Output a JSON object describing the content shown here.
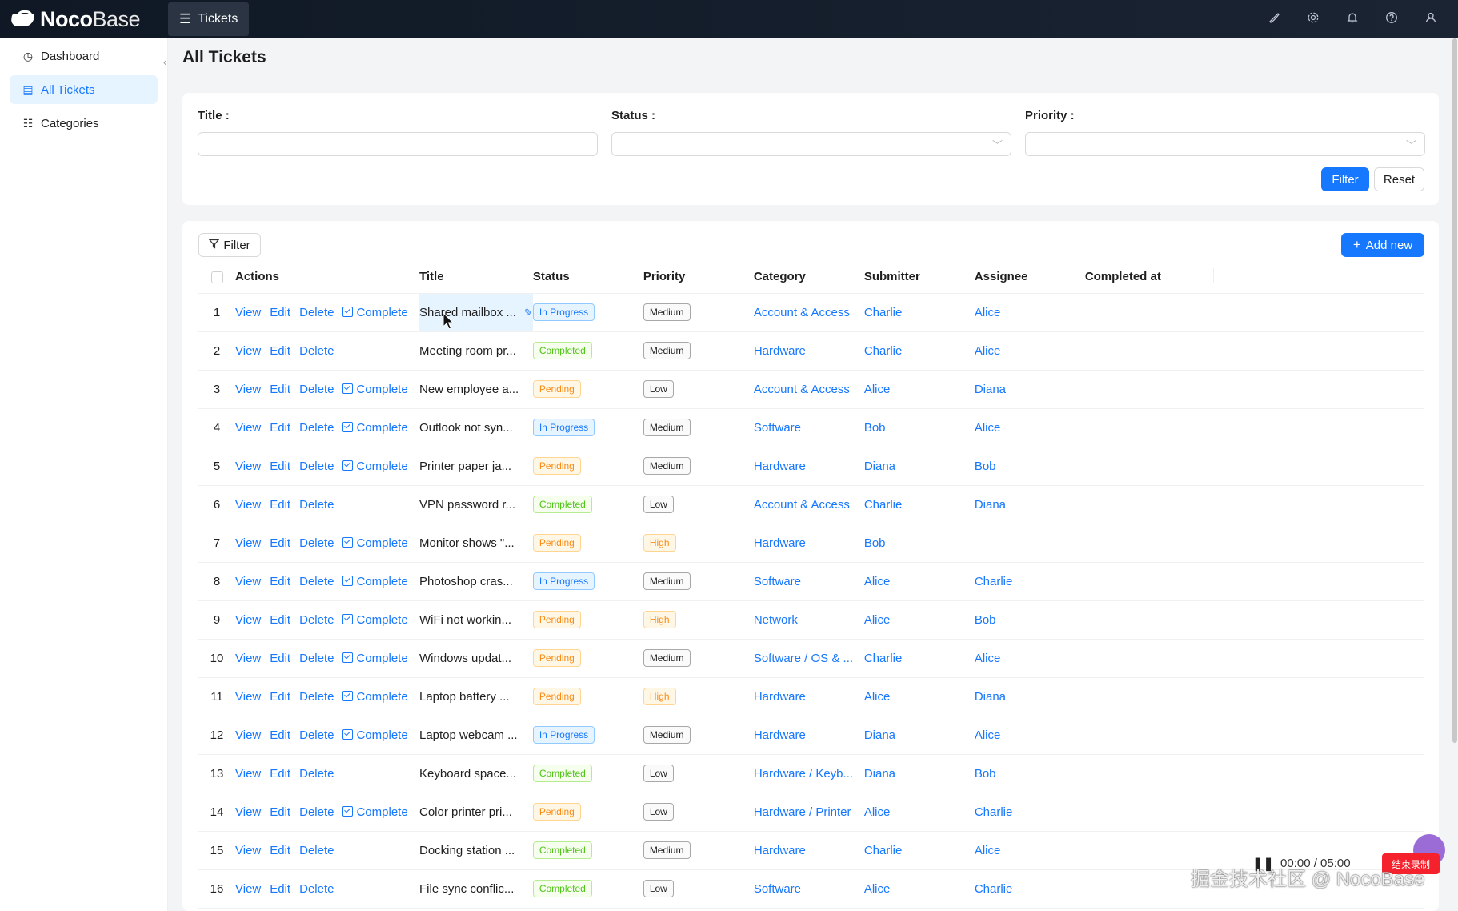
{
  "app": {
    "logo_bold": "Noco",
    "logo_light": "Base",
    "menu_tab": "Tickets"
  },
  "sidebar": {
    "items": [
      {
        "label": "Dashboard",
        "icon": "dashboard-icon",
        "active": false
      },
      {
        "label": "All Tickets",
        "icon": "file-icon",
        "active": true
      },
      {
        "label": "Categories",
        "icon": "list-icon",
        "active": false
      }
    ]
  },
  "page": {
    "title": "All Tickets"
  },
  "filter_form": {
    "title_label": "Title :",
    "status_label": "Status :",
    "priority_label": "Priority :",
    "filter_button": "Filter",
    "reset_button": "Reset"
  },
  "table_toolbar": {
    "filter_button": "Filter",
    "add_new_button": "Add new"
  },
  "table": {
    "columns": [
      "Actions",
      "Title",
      "Status",
      "Priority",
      "Category",
      "Submitter",
      "Assignee",
      "Completed at"
    ],
    "action_labels": {
      "view": "View",
      "edit": "Edit",
      "delete": "Delete",
      "complete": "Complete"
    },
    "rows": [
      {
        "n": "1",
        "complete": true,
        "title": "Shared mailbox ...",
        "status": "In Progress",
        "priority": "Medium",
        "category": "Account & Access",
        "submitter": "Charlie",
        "assignee": "Alice"
      },
      {
        "n": "2",
        "complete": false,
        "title": "Meeting room pr...",
        "status": "Completed",
        "priority": "Medium",
        "category": "Hardware",
        "submitter": "Charlie",
        "assignee": "Alice"
      },
      {
        "n": "3",
        "complete": true,
        "title": "New employee a...",
        "status": "Pending",
        "priority": "Low",
        "category": "Account & Access",
        "submitter": "Alice",
        "assignee": "Diana"
      },
      {
        "n": "4",
        "complete": true,
        "title": "Outlook not syn...",
        "status": "In Progress",
        "priority": "Medium",
        "category": "Software",
        "submitter": "Bob",
        "assignee": "Alice"
      },
      {
        "n": "5",
        "complete": true,
        "title": "Printer paper ja...",
        "status": "Pending",
        "priority": "Medium",
        "category": "Hardware",
        "submitter": "Diana",
        "assignee": "Bob"
      },
      {
        "n": "6",
        "complete": false,
        "title": "VPN password r...",
        "status": "Completed",
        "priority": "Low",
        "category": "Account & Access",
        "submitter": "Charlie",
        "assignee": "Diana"
      },
      {
        "n": "7",
        "complete": true,
        "title": "Monitor shows \"...",
        "status": "Pending",
        "priority": "High",
        "category": "Hardware",
        "submitter": "Bob",
        "assignee": ""
      },
      {
        "n": "8",
        "complete": true,
        "title": "Photoshop cras...",
        "status": "In Progress",
        "priority": "Medium",
        "category": "Software",
        "submitter": "Alice",
        "assignee": "Charlie"
      },
      {
        "n": "9",
        "complete": true,
        "title": "WiFi not workin...",
        "status": "Pending",
        "priority": "High",
        "category": "Network",
        "submitter": "Alice",
        "assignee": "Bob"
      },
      {
        "n": "10",
        "complete": true,
        "title": "Windows updat...",
        "status": "Pending",
        "priority": "Medium",
        "category": "Software / OS & ...",
        "submitter": "Charlie",
        "assignee": "Alice"
      },
      {
        "n": "11",
        "complete": true,
        "title": "Laptop battery ...",
        "status": "Pending",
        "priority": "High",
        "category": "Hardware",
        "submitter": "Alice",
        "assignee": "Diana"
      },
      {
        "n": "12",
        "complete": true,
        "title": "Laptop webcam ...",
        "status": "In Progress",
        "priority": "Medium",
        "category": "Hardware",
        "submitter": "Diana",
        "assignee": "Alice"
      },
      {
        "n": "13",
        "complete": false,
        "title": "Keyboard space...",
        "status": "Completed",
        "priority": "Low",
        "category": "Hardware / Keyb...",
        "submitter": "Diana",
        "assignee": "Bob"
      },
      {
        "n": "14",
        "complete": true,
        "title": "Color printer pri...",
        "status": "Pending",
        "priority": "Low",
        "category": "Hardware / Printer",
        "submitter": "Alice",
        "assignee": "Charlie"
      },
      {
        "n": "15",
        "complete": false,
        "title": "Docking station ...",
        "status": "Completed",
        "priority": "Medium",
        "category": "Hardware",
        "submitter": "Charlie",
        "assignee": "Alice"
      },
      {
        "n": "16",
        "complete": false,
        "title": "File sync conflic...",
        "status": "Completed",
        "priority": "Low",
        "category": "Software",
        "submitter": "Alice",
        "assignee": "Charlie"
      }
    ]
  },
  "recorder": {
    "time": "00:00 / 05:00",
    "stop_button": "结束录制"
  },
  "watermark": "掘金技术社区 @ NocoBase",
  "colors": {
    "primary": "#1677ff",
    "topbar": "#0f1824",
    "in_progress": "#1677ff",
    "completed": "#52c41a",
    "pending": "#fa8c16"
  }
}
